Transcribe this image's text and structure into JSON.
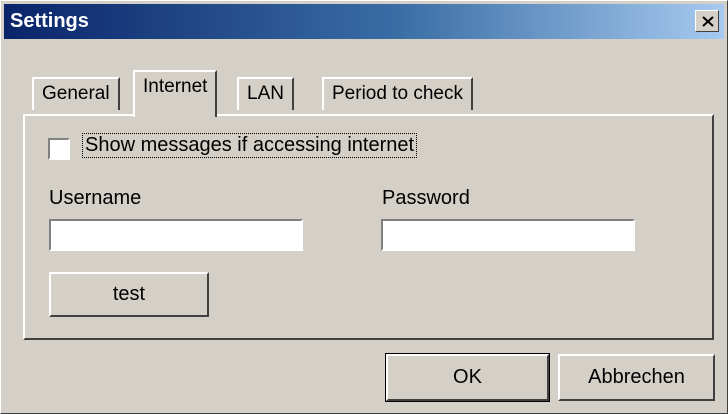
{
  "window": {
    "title": "Settings",
    "close_symbol": "×"
  },
  "tabs": [
    {
      "label": "General",
      "active": false
    },
    {
      "label": "Internet",
      "active": true
    },
    {
      "label": "LAN",
      "active": false
    },
    {
      "label": "Period to check",
      "active": false
    }
  ],
  "internet": {
    "show_messages": {
      "label": "Show messages if accessing internet",
      "checked": false
    },
    "username": {
      "label": "Username",
      "value": ""
    },
    "password": {
      "label": "Password",
      "value": ""
    },
    "test_button": "test"
  },
  "buttons": {
    "ok": "OK",
    "cancel": "Abbrechen"
  },
  "icons": {
    "close": "close-icon"
  }
}
